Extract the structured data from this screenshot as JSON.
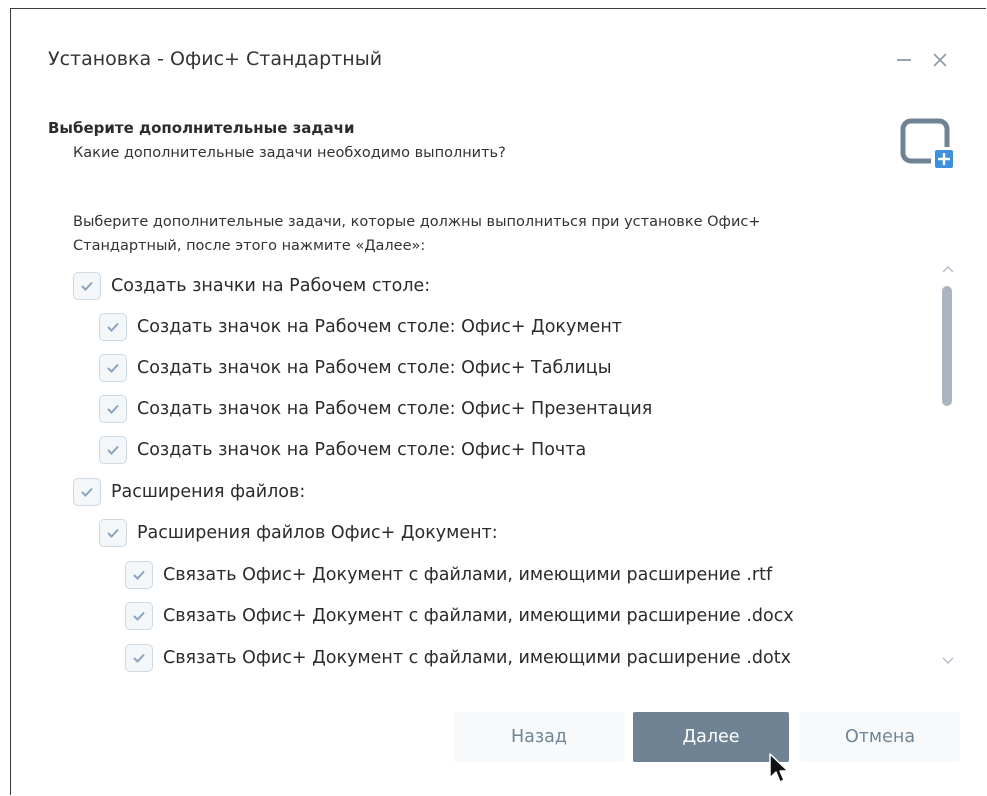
{
  "window": {
    "title": "Установка - Офис+ Стандартный",
    "minimize_glyph": "–",
    "close_glyph": "✕"
  },
  "section": {
    "heading": "Выберите дополнительные задачи",
    "subheading": "Какие дополнительные задачи необходимо выполнить?",
    "icon": "window-plus-icon"
  },
  "intro": {
    "line1": "Выберите дополнительные задачи, которые должны выполниться при установке Офис+",
    "line2": "Стандартный, после этого нажмите «Далее»:"
  },
  "tasks": [
    {
      "label": "Создать значки на Рабочем столе:",
      "checked": true,
      "level": 0
    },
    {
      "label": "Создать значок на Рабочем столе: Офис+ Документ",
      "checked": true,
      "level": 1
    },
    {
      "label": "Создать значок на Рабочем столе: Офис+ Таблицы",
      "checked": true,
      "level": 1
    },
    {
      "label": "Создать значок на Рабочем столе: Офис+ Презентация",
      "checked": true,
      "level": 1
    },
    {
      "label": "Создать значок на Рабочем столе: Офис+ Почта",
      "checked": true,
      "level": 1
    },
    {
      "label": "Расширения файлов:",
      "checked": true,
      "level": 0
    },
    {
      "label": "Расширения файлов Офис+ Документ:",
      "checked": true,
      "level": 1
    },
    {
      "label": "Связать Офис+ Документ с файлами, имеющими расширение .rtf",
      "checked": true,
      "level": 2
    },
    {
      "label": "Связать Офис+ Документ с файлами, имеющими расширение .docx",
      "checked": true,
      "level": 2
    },
    {
      "label": "Связать Офис+ Документ с файлами, имеющими расширение .dotx",
      "checked": true,
      "level": 2
    }
  ],
  "buttons": {
    "back": "Назад",
    "next": "Далее",
    "cancel": "Отмена"
  },
  "colors": {
    "accent": "#6f8394",
    "button_text_secondary": "#6f8597",
    "checkbox_border": "#cfd8e0",
    "check_mark": "#8aa4bd",
    "icon_plus": "#3d8fe0"
  }
}
